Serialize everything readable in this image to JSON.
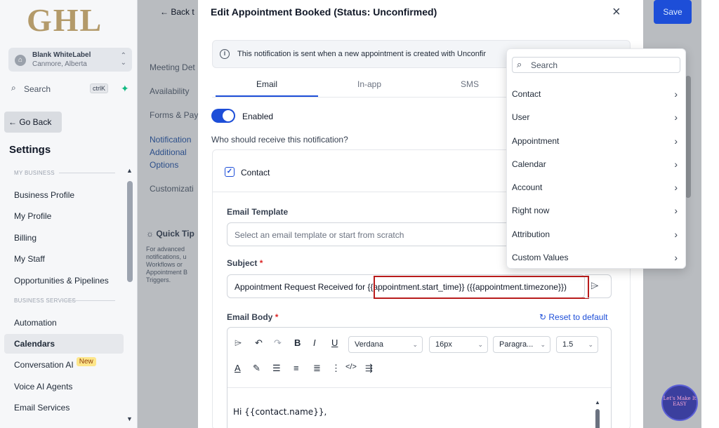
{
  "sidebar": {
    "logo": "GHL",
    "account_name": "Blank WhiteLabel",
    "account_location": "Canmore, Alberta",
    "search_label": "Search",
    "search_shortcut": "ctrlK",
    "go_back": "← Go Back",
    "title": "Settings",
    "section_my_business": "MY BUSINESS",
    "section_business_services": "BUSINESS SERVICES",
    "items": [
      "Business Profile",
      "My Profile",
      "Billing",
      "My Staff",
      "Opportunities & Pipelines",
      "Automation",
      "Calendars",
      "Conversation AI",
      "Voice AI Agents",
      "Email Services"
    ],
    "new_badge": "New"
  },
  "background_page": {
    "back_label": "← Back t",
    "save_label": "Save",
    "nav": [
      "Meeting Det",
      "Availability",
      "Forms & Pay",
      "Notification",
      "Additional",
      "Options",
      "Customizati"
    ],
    "quick_tip_title": "Quick Tip",
    "quick_tip_text": "For advanced notifications, u Workflows or Appointment B Triggers.",
    "badge_text": "Let's Make It EASY"
  },
  "modal": {
    "title": "Edit Appointment Booked (Status: Unconfirmed)",
    "info_text": "This notification is sent when a new appointment is created with Unconfir",
    "tabs": [
      "Email",
      "In-app",
      "SMS"
    ],
    "active_tab": "Email",
    "enabled_label": "Enabled",
    "who_label": "Who should receive this notification?",
    "contact_label": "Contact",
    "email_template_label": "Email Template",
    "email_template_placeholder": "Select an email template or start from scratch",
    "subject_label": "Subject",
    "required_mark": "*",
    "subject_value": "Appointment Request Received for {{appointment.start_time}} ({{appointment.timezone}})",
    "email_body_label": "Email Body",
    "reset_label": "Reset to default",
    "toolbar": {
      "font_family": "Verdana",
      "font_size": "16px",
      "paragraph": "Paragra...",
      "line_height": "1.5"
    },
    "body_text": "Hi {{contact.name}},"
  },
  "picker": {
    "search_placeholder": "Search",
    "items": [
      "Contact",
      "User",
      "Appointment",
      "Calendar",
      "Account",
      "Right now",
      "Attribution",
      "Custom Values"
    ]
  },
  "colors": {
    "primary": "#1d4ed8",
    "highlight_border": "#b91c1c",
    "logo_gold": "#b39a6a",
    "new_badge": "#fde68a"
  }
}
